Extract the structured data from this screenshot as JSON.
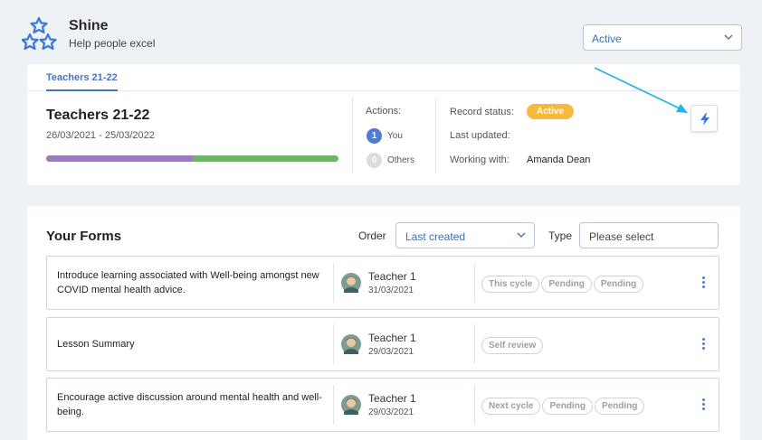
{
  "app": {
    "name": "Shine",
    "tagline": "Help people excel",
    "logo_icon": "stars-logo-icon"
  },
  "status_filter": {
    "value": "Active"
  },
  "record": {
    "tab": "Teachers 21-22",
    "title": "Teachers 21-22",
    "dates": "26/03/2021 - 25/03/2022",
    "progress_fraction": 0.5,
    "actions_label": "Actions:",
    "actions": [
      {
        "count": "1",
        "label": "You"
      },
      {
        "count": "0",
        "label": "Others"
      }
    ],
    "record_status_label": "Record status:",
    "record_status": "Active",
    "last_updated_label": "Last updated:",
    "working_with_label": "Working with:",
    "working_with": "Amanda Dean",
    "quick_action_icon": "lightning-bolt-icon"
  },
  "forms": {
    "title": "Your Forms",
    "order_label": "Order",
    "order_value": "Last created",
    "type_label": "Type",
    "type_placeholder": "Please select",
    "rows": [
      {
        "title": "Introduce learning associated with Well-being amongst new COVID mental health advice.",
        "teacher": "Teacher 1",
        "date": "31/03/2021",
        "tags": [
          "This cycle",
          "Pending",
          "Pending"
        ]
      },
      {
        "title": "Lesson Summary",
        "teacher": "Teacher 1",
        "date": "29/03/2021",
        "tags": [
          "Self review"
        ]
      },
      {
        "title": "Encourage active discussion around mental health and well-being.",
        "teacher": "Teacher 1",
        "date": "29/03/2021",
        "tags": [
          "Next cycle",
          "Pending",
          "Pending"
        ]
      }
    ]
  },
  "colors": {
    "accent": "#4a74b8",
    "active_pill": "#f6b93b",
    "progress_a": "#9b7dbd",
    "progress_b": "#6fb46b",
    "annotation_arrow": "#1fb3e8"
  }
}
